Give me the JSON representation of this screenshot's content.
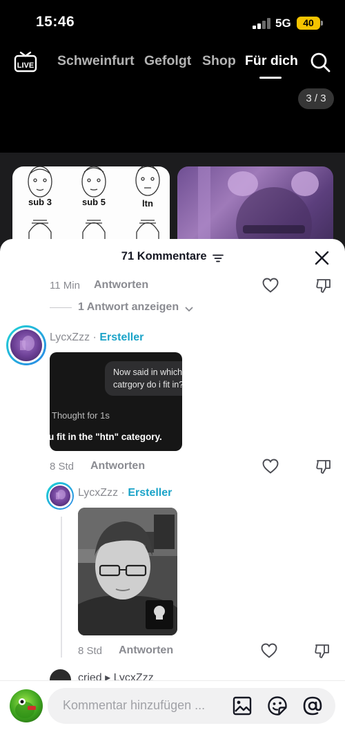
{
  "status_bar": {
    "time": "15:46",
    "network": "5G",
    "battery": "40"
  },
  "top_nav": {
    "live_label": "LIVE",
    "tabs": [
      "Schweinfurt",
      "Gefolgt",
      "Shop",
      "Für dich"
    ],
    "active_tab": "Für dich"
  },
  "media_counter": "3 / 3",
  "background_thumbs": {
    "labels": [
      "sub 3",
      "sub 5",
      "ltn"
    ]
  },
  "comments_sheet": {
    "title": "71 Kommentare",
    "top_comment": {
      "time": "11 Min",
      "reply_label": "Antworten"
    },
    "show_replies": "1 Antwort anzeigen",
    "comments": [
      {
        "username": "LycxZzz",
        "separator": "·",
        "badge": "Ersteller",
        "image_text": {
          "bubble_line1": "Now said in which",
          "bubble_line2": "catrgory do i fit in?",
          "thought": "Thought for 1s",
          "answer": "u fit in the \"htn\" category."
        },
        "time": "8 Std",
        "reply_label": "Antworten"
      },
      {
        "username": "LycxZzz",
        "separator": "·",
        "badge": "Ersteller",
        "time": "8 Std",
        "reply_label": "Antworten"
      }
    ],
    "next_comment": {
      "username": "cried",
      "reply_to": "LycxZzz",
      "arrow": "▸"
    }
  },
  "input_bar": {
    "placeholder": "Kommentar hinzufügen ..."
  },
  "colors": {
    "creator_badge": "#1aa3c8",
    "battery": "#f5c400",
    "avatar_ring": "#1fd4d4"
  }
}
